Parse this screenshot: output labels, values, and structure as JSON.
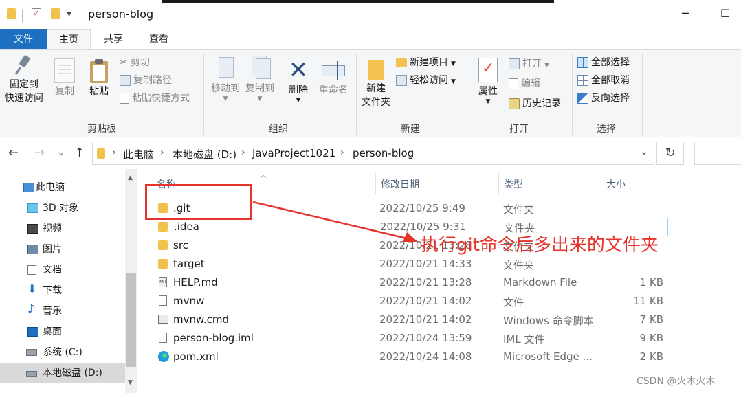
{
  "window": {
    "title": "person-blog",
    "minimize": "─",
    "maximize": "☐"
  },
  "ribbon_tabs": {
    "file": "文件",
    "home": "主页",
    "share": "共享",
    "view": "查看"
  },
  "ribbon": {
    "clipboard": {
      "label": "剪贴板",
      "pin": "固定到\n快速访问",
      "pin_line1": "固定到",
      "pin_line2": "快速访问",
      "copy": "复制",
      "paste": "粘贴",
      "cut": "剪切",
      "copy_path": "复制路径",
      "paste_shortcut": "粘贴快捷方式"
    },
    "organize": {
      "label": "组织",
      "move_to": "移动到",
      "copy_to": "复制到",
      "delete": "删除",
      "rename": "重命名"
    },
    "new": {
      "label": "新建",
      "new_folder_line1": "新建",
      "new_folder_line2": "文件夹",
      "new_item": "新建项目",
      "easy_access": "轻松访问"
    },
    "open": {
      "label": "打开",
      "properties": "属性",
      "open": "打开",
      "edit": "编辑",
      "history": "历史记录"
    },
    "select": {
      "label": "选择",
      "select_all": "全部选择",
      "select_none": "全部取消",
      "invert": "反向选择"
    }
  },
  "address": {
    "crumbs": [
      "此电脑",
      "本地磁盘 (D:)",
      "JavaProject1021",
      "person-blog"
    ]
  },
  "navpane": {
    "items": [
      {
        "label": "此电脑",
        "icon": "computer-icon"
      },
      {
        "label": "3D 对象",
        "icon": "cube-icon"
      },
      {
        "label": "视频",
        "icon": "video-icon"
      },
      {
        "label": "图片",
        "icon": "picture-icon"
      },
      {
        "label": "文档",
        "icon": "document-icon"
      },
      {
        "label": "下载",
        "icon": "download-icon"
      },
      {
        "label": "音乐",
        "icon": "music-icon"
      },
      {
        "label": "桌面",
        "icon": "desktop-icon"
      },
      {
        "label": "系统 (C:)",
        "icon": "drive-c-icon"
      },
      {
        "label": "本地磁盘 (D:)",
        "icon": "drive-d-icon"
      }
    ]
  },
  "columns": {
    "name": "名称",
    "date": "修改日期",
    "type": "类型",
    "size": "大小"
  },
  "files": [
    {
      "name": ".git",
      "date": "2022/10/25 9:49",
      "type": "文件夹",
      "size": "",
      "icon": "folder-icon"
    },
    {
      "name": ".idea",
      "date": "2022/10/25 9:31",
      "type": "文件夹",
      "size": "",
      "icon": "folder-icon"
    },
    {
      "name": "src",
      "date": "2022/10/21 13:28",
      "type": "文件夹",
      "size": "",
      "icon": "folder-icon"
    },
    {
      "name": "target",
      "date": "2022/10/21 14:33",
      "type": "文件夹",
      "size": "",
      "icon": "folder-icon"
    },
    {
      "name": "HELP.md",
      "date": "2022/10/21 13:28",
      "type": "Markdown File",
      "size": "1 KB",
      "icon": "markdown-file-icon"
    },
    {
      "name": "mvnw",
      "date": "2022/10/21 14:02",
      "type": "文件",
      "size": "11 KB",
      "icon": "file-icon"
    },
    {
      "name": "mvnw.cmd",
      "date": "2022/10/21 14:02",
      "type": "Windows 命令脚本",
      "size": "7 KB",
      "icon": "cmd-script-icon"
    },
    {
      "name": "person-blog.iml",
      "date": "2022/10/24 13:59",
      "type": "IML 文件",
      "size": "9 KB",
      "icon": "file-icon"
    },
    {
      "name": "pom.xml",
      "date": "2022/10/24 14:08",
      "type": "Microsoft Edge ...",
      "size": "2 KB",
      "icon": "edge-icon"
    }
  ],
  "annotation": {
    "text": "执行git命令后多出来的文件夹",
    "color": "#e5342b"
  },
  "watermark": "CSDN @火木火木",
  "colors": {
    "accent": "#1e6fc0",
    "folder": "#f2c14e",
    "annotation": "#e5342b"
  }
}
